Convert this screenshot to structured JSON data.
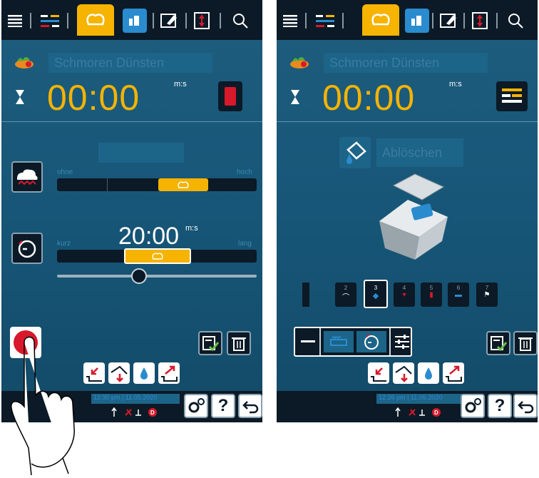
{
  "left_screen": {
    "recipe_name": "Schmoren Dünsten",
    "timer": "00:00",
    "timer_unit": "m:s",
    "slider1": {
      "min_label": "ohne",
      "max_label": "hoch",
      "level": 0.7
    },
    "slider2": {
      "time": "20:00",
      "time_unit": "m:s",
      "min_label": "kurz",
      "max_label": "lang",
      "level": 0.48
    },
    "fine_slider_level": 0.38,
    "status_datetime": "12:30 pm | 11.05.2020"
  },
  "right_screen": {
    "recipe_name": "Schmoren Dünsten",
    "timer": "00:00",
    "timer_unit": "m:s",
    "step_action": "Ablöschen",
    "steps": [
      "2",
      "3",
      "4",
      "5",
      "6",
      "7"
    ],
    "selected_step": "3",
    "status_datetime": "12:26 pm | 11.05.2020"
  },
  "bottom_buttons": {
    "help": "?"
  },
  "colors": {
    "accent": "#f6b300",
    "screen_bg": "#175678",
    "bar_bg": "#0b1a26",
    "record_red": "#d7192b"
  }
}
